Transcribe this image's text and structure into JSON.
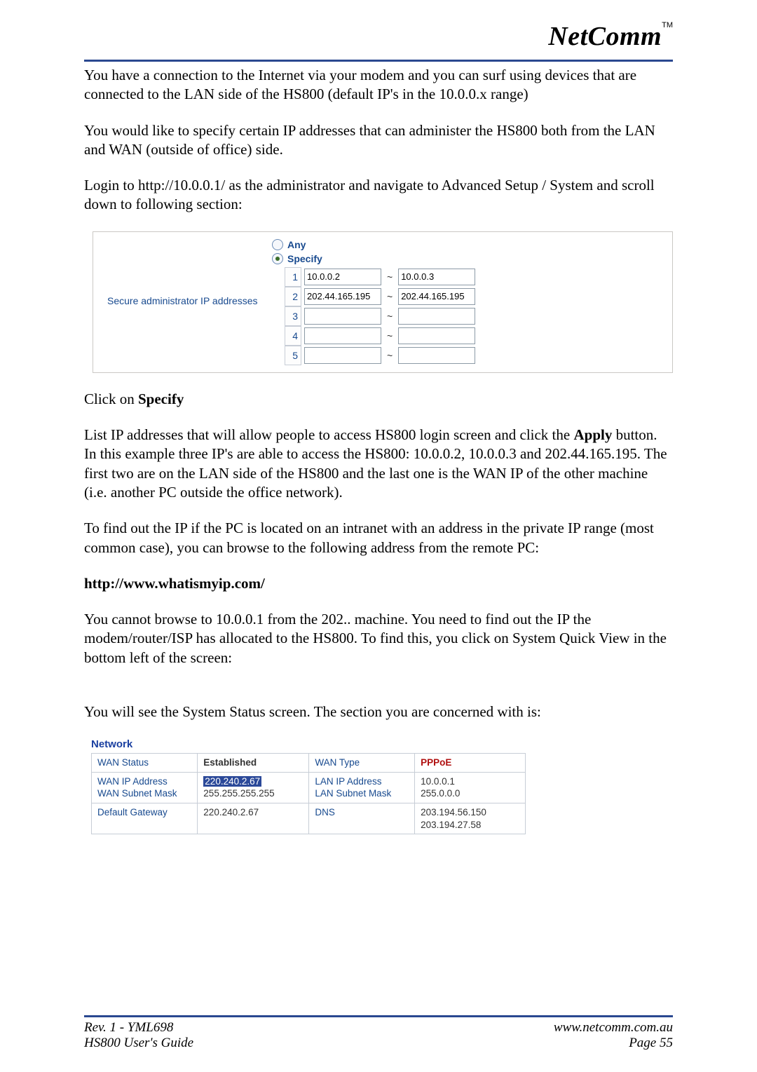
{
  "brand": {
    "name": "NetComm",
    "tm": "TM"
  },
  "paras": {
    "p1": "You have a connection to the Internet via your modem and you can surf using devices that are connected to the LAN side of the HS800 (default IP's in the 10.0.0.x range)",
    "p2": "You would like to specify certain IP addresses that can administer the HS800 both from the LAN and WAN (outside of office) side.",
    "p3": "Login to http://10.0.0.1/ as the administrator and navigate to Advanced Setup / System and scroll down to following section:",
    "p4a": "Click on ",
    "p4b": "Specify",
    "p5a": "List IP addresses that will allow people to access HS800 login screen and click the ",
    "p5b": "Apply",
    "p5c": " button. In this example three IP's are able to access the HS800: 10.0.0.2, 10.0.0.3 and 202.44.165.195. The first two are on the LAN side of the HS800 and the last one is the WAN IP of the other machine (i.e. another PC outside the office network).",
    "p6": "To find out the IP if the PC is located on an intranet with an address in the private IP range (most common case), you can browse to the following address from the remote PC:",
    "p7": "http://www.whatismyip.com/",
    "p8": "You cannot browse to 10.0.0.1 from the 202.. machine. You need to find out the IP the modem/router/ISP has allocated to the HS800. To find this, you click on System Quick View in the bottom left of the screen:",
    "p9": "You will see the System Status screen. The section you are concerned with is:"
  },
  "admin": {
    "label": "Secure administrator IP addresses",
    "radio_any": "Any",
    "radio_specify": "Specify",
    "rows": [
      {
        "idx": "1",
        "from": "10.0.0.2",
        "to": "10.0.0.3"
      },
      {
        "idx": "2",
        "from": "202.44.165.195",
        "to": "202.44.165.195"
      },
      {
        "idx": "3",
        "from": "",
        "to": ""
      },
      {
        "idx": "4",
        "from": "",
        "to": ""
      },
      {
        "idx": "5",
        "from": "",
        "to": ""
      }
    ]
  },
  "network": {
    "heading": "Network",
    "rows": [
      [
        {
          "lbl": "WAN Status",
          "val_bold": "Established"
        },
        {
          "lbl": "WAN Type",
          "val_red": "PPPoE"
        }
      ],
      [
        {
          "lbl2a": "WAN IP Address",
          "lbl2b": "WAN Subnet Mask",
          "val_hl": "220.240.2.67",
          "val2": "255.255.255.255"
        },
        {
          "lbl2a": "LAN IP Address",
          "lbl2b": "LAN Subnet Mask",
          "val2a": "10.0.0.1",
          "val2b": "255.0.0.0"
        }
      ],
      [
        {
          "lbl": "Default Gateway",
          "val": "220.240.2.67"
        },
        {
          "lbl": "DNS",
          "val2a": "203.194.56.150",
          "val2b": "203.194.27.58"
        }
      ]
    ]
  },
  "footer": {
    "left1": "Rev. 1 - YML698",
    "left2": "HS800 User's Guide",
    "right1": "www.netcomm.com.au",
    "right2": "Page 55"
  }
}
